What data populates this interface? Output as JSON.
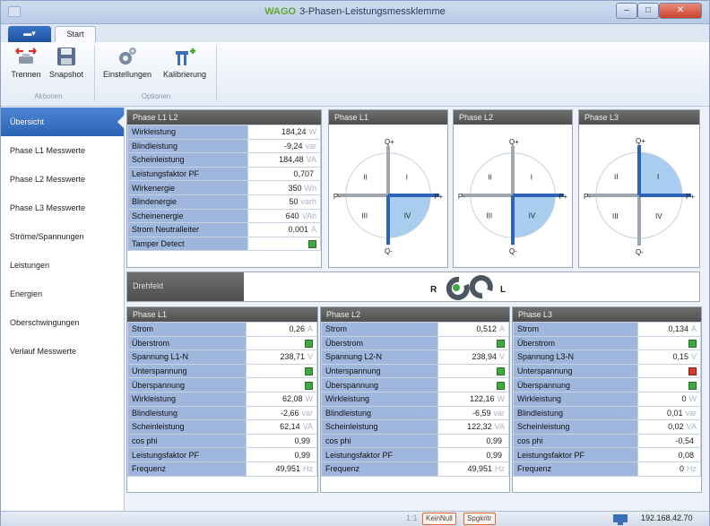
{
  "window": {
    "title": "3-Phasen-Leistungsmessklemme",
    "logo": "WAGO",
    "min": "–",
    "max": "□",
    "close": "✕"
  },
  "ribbon": {
    "file_tab": "▬▾",
    "start_tab": "Start",
    "buttons": {
      "trennen": "Trennen",
      "snapshot": "Snapshot",
      "einstellungen": "Einstellungen",
      "kalibrierung": "Kalibrierung"
    },
    "groups": {
      "aktionen": "Aktionen",
      "optionen": "Optionen"
    }
  },
  "sidebar": {
    "items": [
      "Übersicht",
      "Phase L1 Messwerte",
      "Phase L2 Messwerte",
      "Phase L3 Messwerte",
      "Ströme/Spannungen",
      "Leistungen",
      "Energien",
      "Oberschwingungen",
      "Verlauf Messwerte"
    ]
  },
  "summary": {
    "title": "Phase L1 L2",
    "rows": [
      {
        "label": "Wirkleistung",
        "value": "184,24",
        "unit": "W"
      },
      {
        "label": "Blindleistung",
        "value": "-9,24",
        "unit": "var"
      },
      {
        "label": "Scheinleistung",
        "value": "184,48",
        "unit": "VA"
      },
      {
        "label": "Leistungsfaktor PF",
        "value": "0,707",
        "unit": ""
      },
      {
        "label": "Wirkenergie",
        "value": "350",
        "unit": "Wh"
      },
      {
        "label": "Blindenergie",
        "value": "50",
        "unit": "varh"
      },
      {
        "label": "Scheinenergie",
        "value": "640",
        "unit": "VAh"
      },
      {
        "label": "Strom Neutralleiter",
        "value": "0,001",
        "unit": "A"
      },
      {
        "label": "Tamper Detect",
        "value": "",
        "unit": ""
      }
    ]
  },
  "quadrants": [
    {
      "title": "Phase L1",
      "q_plus": "Q+",
      "q_minus": "Q-",
      "p_plus": "P+",
      "p_minus": "P-",
      "I": "I",
      "II": "II",
      "III": "III",
      "IV": "IV"
    },
    {
      "title": "Phase L2",
      "q_plus": "Q+",
      "q_minus": "Q-",
      "p_plus": "P+",
      "p_minus": "P-",
      "I": "I",
      "II": "II",
      "III": "III",
      "IV": "IV"
    },
    {
      "title": "Phase L3",
      "q_plus": "Q+",
      "q_minus": "Q-",
      "p_plus": "P+",
      "p_minus": "P-",
      "I": "I",
      "II": "II",
      "III": "III",
      "IV": "IV"
    }
  ],
  "drehfeld": {
    "title": "Drehfeld",
    "r": "R",
    "l": "L"
  },
  "phases": [
    {
      "title": "Phase L1",
      "rows": [
        {
          "label": "Strom",
          "value": "0,26",
          "unit": "A"
        },
        {
          "label": "Überstrom",
          "value": "",
          "unit": ""
        },
        {
          "label": "Spannung L1-N",
          "value": "238,71",
          "unit": "V"
        },
        {
          "label": "Unterspannung",
          "value": "",
          "unit": ""
        },
        {
          "label": "Überspannung",
          "value": "",
          "unit": ""
        },
        {
          "label": "Wirkleistung",
          "value": "62,08",
          "unit": "W"
        },
        {
          "label": "Blindleistung",
          "value": "-2,66",
          "unit": "var"
        },
        {
          "label": "Scheinleistung",
          "value": "62,14",
          "unit": "VA"
        },
        {
          "label": "cos phi",
          "value": "0,99",
          "unit": ""
        },
        {
          "label": "Leistungsfaktor PF",
          "value": "0,99",
          "unit": ""
        },
        {
          "label": "Frequenz",
          "value": "49,951",
          "unit": "Hz"
        }
      ]
    },
    {
      "title": "Phase L2",
      "rows": [
        {
          "label": "Strom",
          "value": "0,512",
          "unit": "A"
        },
        {
          "label": "Überstrom",
          "value": "",
          "unit": ""
        },
        {
          "label": "Spannung L2-N",
          "value": "238,94",
          "unit": "V"
        },
        {
          "label": "Unterspannung",
          "value": "",
          "unit": ""
        },
        {
          "label": "Überspannung",
          "value": "",
          "unit": ""
        },
        {
          "label": "Wirkleistung",
          "value": "122,16",
          "unit": "W"
        },
        {
          "label": "Blindleistung",
          "value": "-6,59",
          "unit": "var"
        },
        {
          "label": "Scheinleistung",
          "value": "122,32",
          "unit": "VA"
        },
        {
          "label": "cos phi",
          "value": "0,99",
          "unit": ""
        },
        {
          "label": "Leistungsfaktor PF",
          "value": "0,99",
          "unit": ""
        },
        {
          "label": "Frequenz",
          "value": "49,951",
          "unit": "Hz"
        }
      ]
    },
    {
      "title": "Phase L3",
      "rows": [
        {
          "label": "Strom",
          "value": "0,134",
          "unit": "A"
        },
        {
          "label": "Überstrom",
          "value": "",
          "unit": ""
        },
        {
          "label": "Spannung L3-N",
          "value": "0,15",
          "unit": "V"
        },
        {
          "label": "Unterspannung",
          "value": "",
          "unit": ""
        },
        {
          "label": "Überspannung",
          "value": "",
          "unit": ""
        },
        {
          "label": "Wirkleistung",
          "value": "0",
          "unit": "W"
        },
        {
          "label": "Blindleistung",
          "value": "0,01",
          "unit": "var"
        },
        {
          "label": "Scheinleistung",
          "value": "0,02",
          "unit": "VA"
        },
        {
          "label": "cos phi",
          "value": "-0,54",
          "unit": ""
        },
        {
          "label": "Leistungsfaktor PF",
          "value": "0,08",
          "unit": ""
        },
        {
          "label": "Frequenz",
          "value": "0",
          "unit": "Hz"
        }
      ]
    }
  ],
  "status": {
    "prefix": "1:1",
    "btn1": "KeinNull",
    "btn2": "Spgkritr",
    "ip": "192.168.42.70"
  },
  "colors": {
    "accent": "#2c63b5",
    "label_bg": "#9fb6dd",
    "led_ok": "#3caa3c",
    "led_alarm": "#d33a2a"
  }
}
